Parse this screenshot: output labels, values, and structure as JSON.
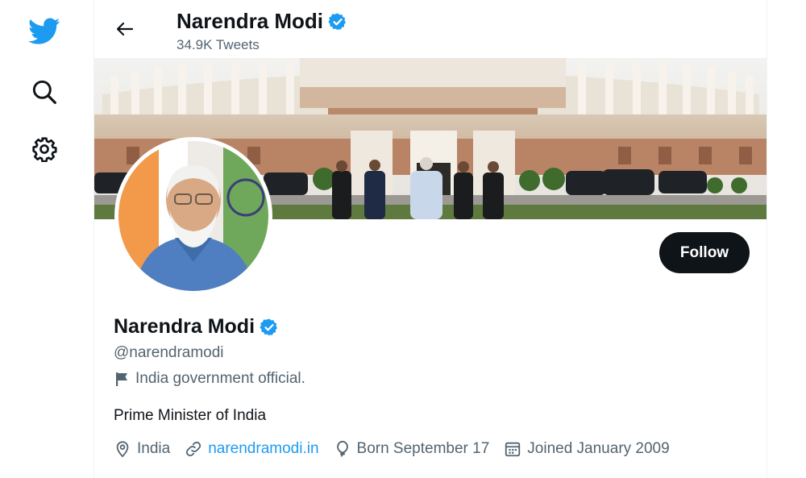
{
  "nav": {
    "items": [
      {
        "icon": "twitter-logo-icon",
        "color": "#1d9bf0"
      },
      {
        "icon": "search-icon"
      },
      {
        "icon": "gear-icon"
      }
    ]
  },
  "header": {
    "name": "Narendra Modi",
    "tweet_count": "34.9K Tweets"
  },
  "profile": {
    "name": "Narendra Modi",
    "handle": "@narendramodi",
    "label": "India government official.",
    "bio": "Prime Minister of India",
    "follow_label": "Follow",
    "location": "India",
    "website": "narendramodi.in",
    "birthday": "Born September 17",
    "joined": "Joined January 2009",
    "verified_color": "#1d9bf0"
  },
  "colors": {
    "accent": "#1d9bf0",
    "text_primary": "#0f1419",
    "text_secondary": "#536471"
  }
}
